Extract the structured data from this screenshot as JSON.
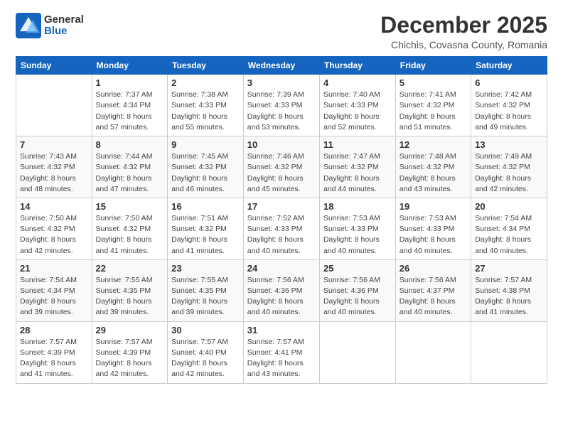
{
  "logo": {
    "general": "General",
    "blue": "Blue"
  },
  "title": "December 2025",
  "location": "Chichis, Covasna County, Romania",
  "weekdays": [
    "Sunday",
    "Monday",
    "Tuesday",
    "Wednesday",
    "Thursday",
    "Friday",
    "Saturday"
  ],
  "weeks": [
    [
      {
        "day": "",
        "sunrise": "",
        "sunset": "",
        "daylight": ""
      },
      {
        "day": "1",
        "sunrise": "Sunrise: 7:37 AM",
        "sunset": "Sunset: 4:34 PM",
        "daylight": "Daylight: 8 hours and 57 minutes."
      },
      {
        "day": "2",
        "sunrise": "Sunrise: 7:38 AM",
        "sunset": "Sunset: 4:33 PM",
        "daylight": "Daylight: 8 hours and 55 minutes."
      },
      {
        "day": "3",
        "sunrise": "Sunrise: 7:39 AM",
        "sunset": "Sunset: 4:33 PM",
        "daylight": "Daylight: 8 hours and 53 minutes."
      },
      {
        "day": "4",
        "sunrise": "Sunrise: 7:40 AM",
        "sunset": "Sunset: 4:33 PM",
        "daylight": "Daylight: 8 hours and 52 minutes."
      },
      {
        "day": "5",
        "sunrise": "Sunrise: 7:41 AM",
        "sunset": "Sunset: 4:32 PM",
        "daylight": "Daylight: 8 hours and 51 minutes."
      },
      {
        "day": "6",
        "sunrise": "Sunrise: 7:42 AM",
        "sunset": "Sunset: 4:32 PM",
        "daylight": "Daylight: 8 hours and 49 minutes."
      }
    ],
    [
      {
        "day": "7",
        "sunrise": "Sunrise: 7:43 AM",
        "sunset": "Sunset: 4:32 PM",
        "daylight": "Daylight: 8 hours and 48 minutes."
      },
      {
        "day": "8",
        "sunrise": "Sunrise: 7:44 AM",
        "sunset": "Sunset: 4:32 PM",
        "daylight": "Daylight: 8 hours and 47 minutes."
      },
      {
        "day": "9",
        "sunrise": "Sunrise: 7:45 AM",
        "sunset": "Sunset: 4:32 PM",
        "daylight": "Daylight: 8 hours and 46 minutes."
      },
      {
        "day": "10",
        "sunrise": "Sunrise: 7:46 AM",
        "sunset": "Sunset: 4:32 PM",
        "daylight": "Daylight: 8 hours and 45 minutes."
      },
      {
        "day": "11",
        "sunrise": "Sunrise: 7:47 AM",
        "sunset": "Sunset: 4:32 PM",
        "daylight": "Daylight: 8 hours and 44 minutes."
      },
      {
        "day": "12",
        "sunrise": "Sunrise: 7:48 AM",
        "sunset": "Sunset: 4:32 PM",
        "daylight": "Daylight: 8 hours and 43 minutes."
      },
      {
        "day": "13",
        "sunrise": "Sunrise: 7:49 AM",
        "sunset": "Sunset: 4:32 PM",
        "daylight": "Daylight: 8 hours and 42 minutes."
      }
    ],
    [
      {
        "day": "14",
        "sunrise": "Sunrise: 7:50 AM",
        "sunset": "Sunset: 4:32 PM",
        "daylight": "Daylight: 8 hours and 42 minutes."
      },
      {
        "day": "15",
        "sunrise": "Sunrise: 7:50 AM",
        "sunset": "Sunset: 4:32 PM",
        "daylight": "Daylight: 8 hours and 41 minutes."
      },
      {
        "day": "16",
        "sunrise": "Sunrise: 7:51 AM",
        "sunset": "Sunset: 4:32 PM",
        "daylight": "Daylight: 8 hours and 41 minutes."
      },
      {
        "day": "17",
        "sunrise": "Sunrise: 7:52 AM",
        "sunset": "Sunset: 4:33 PM",
        "daylight": "Daylight: 8 hours and 40 minutes."
      },
      {
        "day": "18",
        "sunrise": "Sunrise: 7:53 AM",
        "sunset": "Sunset: 4:33 PM",
        "daylight": "Daylight: 8 hours and 40 minutes."
      },
      {
        "day": "19",
        "sunrise": "Sunrise: 7:53 AM",
        "sunset": "Sunset: 4:33 PM",
        "daylight": "Daylight: 8 hours and 40 minutes."
      },
      {
        "day": "20",
        "sunrise": "Sunrise: 7:54 AM",
        "sunset": "Sunset: 4:34 PM",
        "daylight": "Daylight: 8 hours and 40 minutes."
      }
    ],
    [
      {
        "day": "21",
        "sunrise": "Sunrise: 7:54 AM",
        "sunset": "Sunset: 4:34 PM",
        "daylight": "Daylight: 8 hours and 39 minutes."
      },
      {
        "day": "22",
        "sunrise": "Sunrise: 7:55 AM",
        "sunset": "Sunset: 4:35 PM",
        "daylight": "Daylight: 8 hours and 39 minutes."
      },
      {
        "day": "23",
        "sunrise": "Sunrise: 7:55 AM",
        "sunset": "Sunset: 4:35 PM",
        "daylight": "Daylight: 8 hours and 39 minutes."
      },
      {
        "day": "24",
        "sunrise": "Sunrise: 7:56 AM",
        "sunset": "Sunset: 4:36 PM",
        "daylight": "Daylight: 8 hours and 40 minutes."
      },
      {
        "day": "25",
        "sunrise": "Sunrise: 7:56 AM",
        "sunset": "Sunset: 4:36 PM",
        "daylight": "Daylight: 8 hours and 40 minutes."
      },
      {
        "day": "26",
        "sunrise": "Sunrise: 7:56 AM",
        "sunset": "Sunset: 4:37 PM",
        "daylight": "Daylight: 8 hours and 40 minutes."
      },
      {
        "day": "27",
        "sunrise": "Sunrise: 7:57 AM",
        "sunset": "Sunset: 4:38 PM",
        "daylight": "Daylight: 8 hours and 41 minutes."
      }
    ],
    [
      {
        "day": "28",
        "sunrise": "Sunrise: 7:57 AM",
        "sunset": "Sunset: 4:39 PM",
        "daylight": "Daylight: 8 hours and 41 minutes."
      },
      {
        "day": "29",
        "sunrise": "Sunrise: 7:57 AM",
        "sunset": "Sunset: 4:39 PM",
        "daylight": "Daylight: 8 hours and 42 minutes."
      },
      {
        "day": "30",
        "sunrise": "Sunrise: 7:57 AM",
        "sunset": "Sunset: 4:40 PM",
        "daylight": "Daylight: 8 hours and 42 minutes."
      },
      {
        "day": "31",
        "sunrise": "Sunrise: 7:57 AM",
        "sunset": "Sunset: 4:41 PM",
        "daylight": "Daylight: 8 hours and 43 minutes."
      },
      {
        "day": "",
        "sunrise": "",
        "sunset": "",
        "daylight": ""
      },
      {
        "day": "",
        "sunrise": "",
        "sunset": "",
        "daylight": ""
      },
      {
        "day": "",
        "sunrise": "",
        "sunset": "",
        "daylight": ""
      }
    ]
  ]
}
